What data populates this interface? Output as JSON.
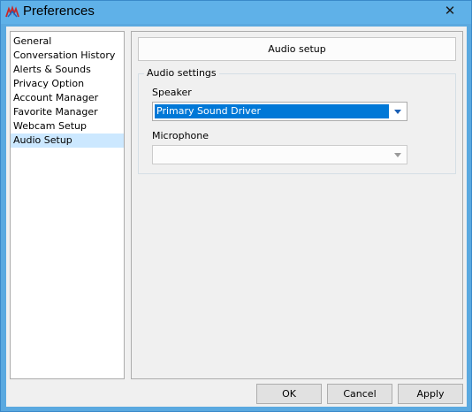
{
  "window": {
    "title": "Preferences",
    "close_glyph": "✕"
  },
  "nav": {
    "items": [
      {
        "label": "General"
      },
      {
        "label": "Conversation History"
      },
      {
        "label": "Alerts & Sounds"
      },
      {
        "label": "Privacy Option"
      },
      {
        "label": "Account Manager"
      },
      {
        "label": "Favorite Manager"
      },
      {
        "label": "Webcam Setup"
      },
      {
        "label": "Audio Setup",
        "selected": true
      }
    ]
  },
  "panel": {
    "header": "Audio setup",
    "group_title": "Audio settings",
    "speaker": {
      "label": "Speaker",
      "value": "Primary Sound Driver"
    },
    "microphone": {
      "label": "Microphone",
      "value": ""
    }
  },
  "buttons": {
    "ok": "OK",
    "cancel": "Cancel",
    "apply": "Apply"
  },
  "colors": {
    "titlebar": "#5fb1e8",
    "selection": "#0078d7",
    "nav_selection": "#cce8ff"
  },
  "icons": {
    "app": "app-logo-icon",
    "close": "close-icon",
    "dropdown": "chevron-down-icon"
  }
}
